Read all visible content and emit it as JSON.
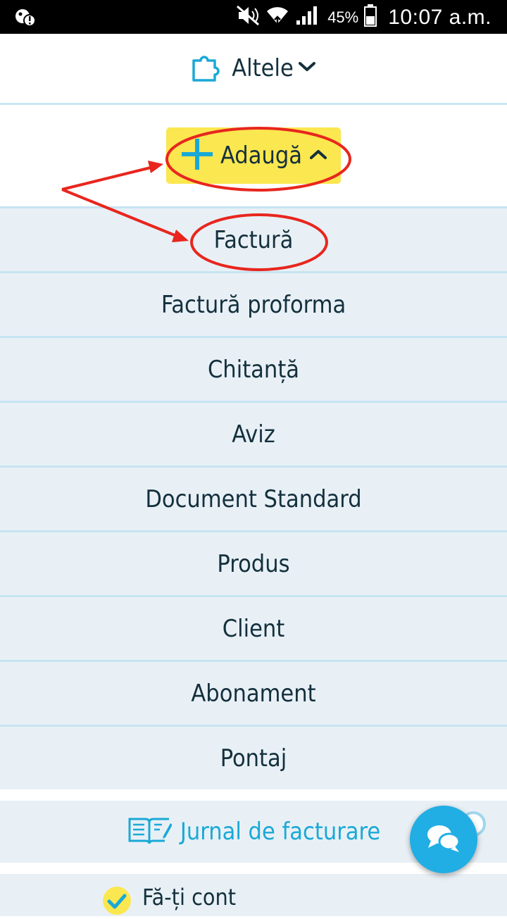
{
  "status_bar": {
    "battery_percent": "45%",
    "time": "10:07 a.m.",
    "icons": [
      "notification-icon",
      "mute-icon",
      "wifi-icon",
      "signal-icon",
      "battery-icon"
    ]
  },
  "header": {
    "title": "Altele",
    "icon": "puzzle-icon",
    "chevron": "chevron-down-icon"
  },
  "add_button": {
    "label": "Adaugă",
    "icon": "plus-icon",
    "chevron": "chevron-up-icon"
  },
  "menu": {
    "items": [
      {
        "label": "Factură"
      },
      {
        "label": "Factură proforma"
      },
      {
        "label": "Chitanță"
      },
      {
        "label": "Aviz"
      },
      {
        "label": "Document Standard"
      },
      {
        "label": "Produs"
      },
      {
        "label": "Client"
      },
      {
        "label": "Abonament"
      },
      {
        "label": "Pontaj"
      }
    ]
  },
  "journal": {
    "label": "Jurnal de facturare",
    "icon": "book-edit-icon"
  },
  "account": {
    "label": "Fă-ți cont",
    "icon": "check-circle-icon"
  },
  "chat": {
    "icon": "chat-bubbles-icon"
  },
  "colors": {
    "accent": "#21aee4",
    "highlight": "#fbe74f",
    "menu_bg": "#e8f0f6",
    "separator": "#c6e4f2",
    "annotation": "#e8261e"
  }
}
